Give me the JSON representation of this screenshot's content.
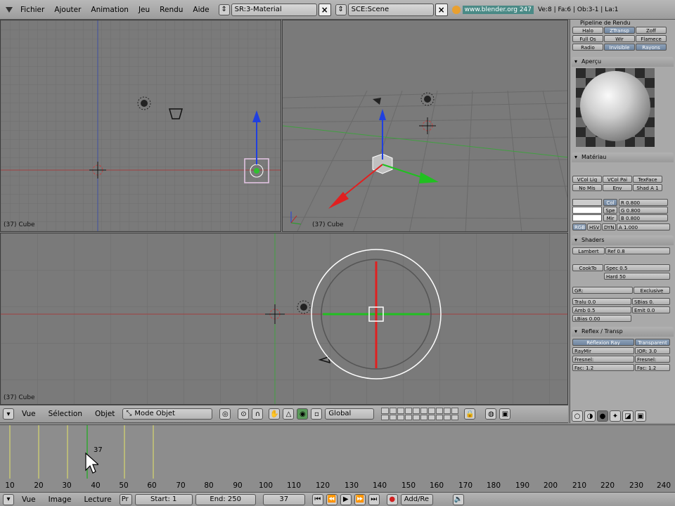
{
  "menu": {
    "items": [
      "Fichier",
      "Ajouter",
      "Animation",
      "Jeu",
      "Rendu",
      "Aide"
    ],
    "screen": "SR:3-Material",
    "scene": "SCE:Scene",
    "url": "www.blender.org 247",
    "stats": "Ve:8 | Fa:6 | Ob:3-1 | La:1"
  },
  "viewports": {
    "top_left_label": "(37) Cube",
    "top_right_label": "(37) Cube",
    "bottom_label": "(37) Cube"
  },
  "right_panel": {
    "pipeline_title": "Pipeline de Rendu",
    "pipeline_row1": [
      "Halo",
      "ZTransp",
      "Zoff"
    ],
    "pipeline_row2": [
      "Full Os",
      "Wir",
      "Flamece"
    ],
    "pipeline_row3": [
      "Radio",
      "Invisible",
      "Rayons"
    ],
    "preview_title": "Aperçu",
    "material_title": "Matériau",
    "mat_row1": [
      "VCol Lig",
      "VCol Pai",
      "TexFace"
    ],
    "mat_row2": [
      "No Mis",
      "Env",
      "Shad A 1"
    ],
    "col_labels": [
      "Col",
      "Spe",
      "Mir"
    ],
    "col_values": [
      "R 0.800",
      "G 0.800",
      "B 0.800"
    ],
    "mode_buttons": [
      "RGB",
      "HSV",
      "DYN"
    ],
    "alpha": "A 1.000",
    "shaders_title": "Shaders",
    "lambert": "Lambert",
    "ref": "Ref 0.8",
    "cooktorr": "CookTo",
    "spec": "Spec 0.5",
    "hard": "Hard 50",
    "gr": "GR:",
    "exclusive": "Exclusive",
    "tralu": "Tralu 0.0",
    "sbias": "SBias 0.",
    "amb": "Amb 0.5",
    "emit": "Emit 0.0",
    "lbias": "LBias 0.00",
    "mirror_title": "Reflex / Transp",
    "ray_mirror": "Réflexion Ray",
    "transparent": "Transparent",
    "raymir": "RayMir",
    "ior": "IOR: 3.0",
    "fresnel_a": "Fresnel:",
    "fresnel_b": "Fresnel:",
    "fac_a": "Fac: 1.2",
    "fac_b": "Fac: 1.2"
  },
  "header3d": {
    "view": "Vue",
    "select": "Sélection",
    "object": "Objet",
    "mode": "Mode Objet",
    "orientation": "Global"
  },
  "timeline": {
    "current_frame_label": "37",
    "ticks": [
      "10",
      "20",
      "30",
      "40",
      "50",
      "60",
      "70",
      "80",
      "90",
      "100",
      "110",
      "120",
      "130",
      "140",
      "150",
      "160",
      "170",
      "180",
      "190",
      "200",
      "210",
      "220",
      "230",
      "240"
    ],
    "header": {
      "view": "Vue",
      "image": "Image",
      "playback": "Lecture",
      "pr": "Pr",
      "start": "Start: 1",
      "end": "End: 250",
      "current": "37",
      "addre": "Add/Re"
    }
  }
}
